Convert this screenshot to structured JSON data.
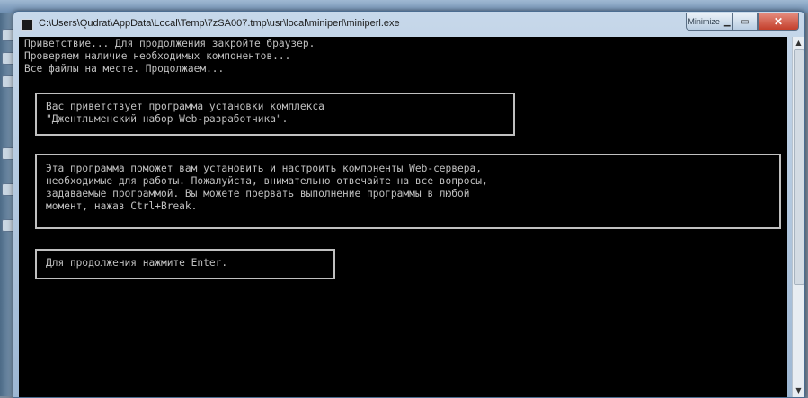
{
  "window": {
    "title": "C:\\Users\\Qudrat\\AppData\\Local\\Temp\\7zSA007.tmp\\usr\\local\\miniperl\\miniperl.exe",
    "minimize_label": "Minimize"
  },
  "terminal": {
    "lines": [
      "Приветствие... Для продолжения закройте браузер.",
      "Проверяем наличие необходимых компонентов...",
      "Все файлы на месте. Продолжаем..."
    ],
    "welcome_box": [
      "Вас приветствует программа установки комплекса",
      "\"Джентльменский набор Web-разработчика\"."
    ],
    "info_box": [
      "Эта программа поможет вам установить и настроить компоненты Web-сервера,",
      "необходимые для работы. Пожалуйста, внимательно отвечайте на все вопросы,",
      "задаваемые программой. Вы можете прервать выполнение программы в любой",
      "момент, нажав Ctrl+Break."
    ],
    "prompt_box": [
      "Для продолжения нажмите Enter."
    ]
  },
  "colors": {
    "console_bg": "#000000",
    "console_text": "#c0c0c0",
    "close_button": "#c4402c"
  },
  "icons": {
    "window_icon": "console-icon",
    "close_icon": "close-x-icon",
    "maximize_icon": "maximize-icon",
    "minimize_icon": "minimize-icon"
  }
}
